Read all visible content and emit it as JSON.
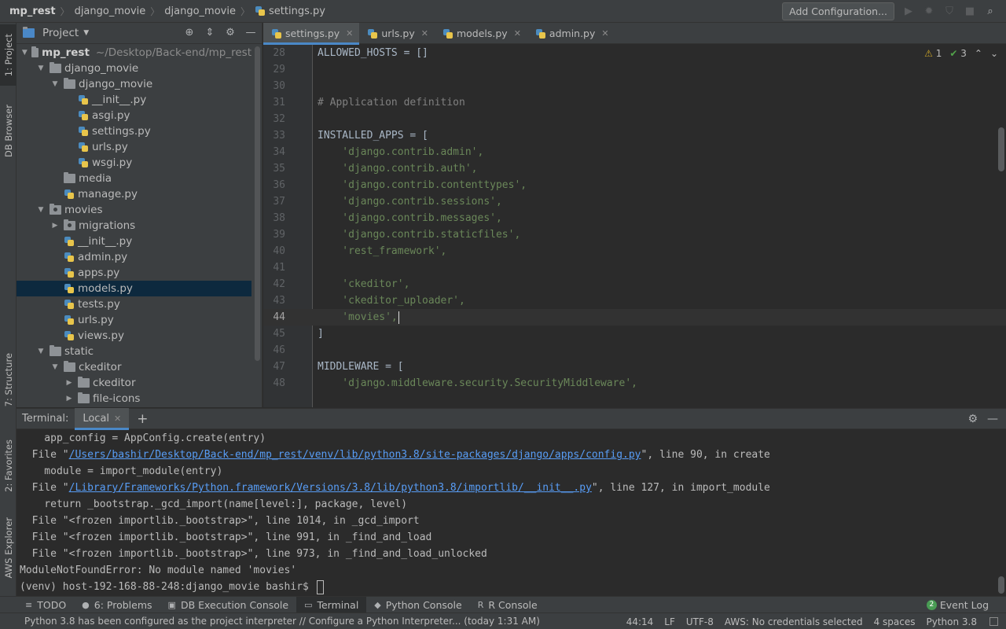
{
  "navbar": {
    "crumbs": [
      "mp_rest",
      "django_movie",
      "django_movie",
      "settings.py"
    ],
    "add_config_label": "Add Configuration..."
  },
  "left_strip": {
    "tabs": [
      "1: Project",
      "DB Browser",
      "7: Structure",
      "2: Favorites",
      "AWS Explorer"
    ]
  },
  "project": {
    "title": "Project",
    "tree": [
      {
        "label": "mp_rest",
        "sub": "~/Desktop/Back-end/mp_rest",
        "depth": 0,
        "type": "folder",
        "arrow": "down",
        "bold": true
      },
      {
        "label": "django_movie",
        "depth": 1,
        "type": "folder",
        "arrow": "down"
      },
      {
        "label": "django_movie",
        "depth": 2,
        "type": "folder",
        "arrow": "down"
      },
      {
        "label": "__init__.py",
        "depth": 3,
        "type": "py"
      },
      {
        "label": "asgi.py",
        "depth": 3,
        "type": "py"
      },
      {
        "label": "settings.py",
        "depth": 3,
        "type": "py"
      },
      {
        "label": "urls.py",
        "depth": 3,
        "type": "py"
      },
      {
        "label": "wsgi.py",
        "depth": 3,
        "type": "py"
      },
      {
        "label": "media",
        "depth": 2,
        "type": "folder"
      },
      {
        "label": "manage.py",
        "depth": 2,
        "type": "py"
      },
      {
        "label": "movies",
        "depth": 1,
        "type": "package",
        "arrow": "down"
      },
      {
        "label": "migrations",
        "depth": 2,
        "type": "package",
        "arrow": "right"
      },
      {
        "label": "__init__.py",
        "depth": 2,
        "type": "py"
      },
      {
        "label": "admin.py",
        "depth": 2,
        "type": "py"
      },
      {
        "label": "apps.py",
        "depth": 2,
        "type": "py"
      },
      {
        "label": "models.py",
        "depth": 2,
        "type": "py",
        "selected": true
      },
      {
        "label": "tests.py",
        "depth": 2,
        "type": "py"
      },
      {
        "label": "urls.py",
        "depth": 2,
        "type": "py"
      },
      {
        "label": "views.py",
        "depth": 2,
        "type": "py"
      },
      {
        "label": "static",
        "depth": 1,
        "type": "folder",
        "arrow": "down"
      },
      {
        "label": "ckeditor",
        "depth": 2,
        "type": "folder",
        "arrow": "down"
      },
      {
        "label": "ckeditor",
        "depth": 3,
        "type": "folder",
        "arrow": "right"
      },
      {
        "label": "file-icons",
        "depth": 3,
        "type": "folder",
        "arrow": "right"
      }
    ]
  },
  "editor": {
    "tabs": [
      {
        "label": "settings.py",
        "active": true
      },
      {
        "label": "urls.py"
      },
      {
        "label": "models.py"
      },
      {
        "label": "admin.py"
      }
    ],
    "warnings": "1",
    "checks": "3",
    "current_line": 44,
    "lines": [
      {
        "n": "28",
        "text": "ALLOWED_HOSTS = []",
        "kind": "code"
      },
      {
        "n": "29",
        "text": "",
        "kind": "code"
      },
      {
        "n": "30",
        "text": "",
        "kind": "code"
      },
      {
        "n": "31",
        "text": "# Application definition",
        "kind": "comment"
      },
      {
        "n": "32",
        "text": "",
        "kind": "code"
      },
      {
        "n": "33",
        "text": "INSTALLED_APPS = [",
        "kind": "code"
      },
      {
        "n": "34",
        "text": "    'django.contrib.admin',",
        "kind": "str"
      },
      {
        "n": "35",
        "text": "    'django.contrib.auth',",
        "kind": "str"
      },
      {
        "n": "36",
        "text": "    'django.contrib.contenttypes',",
        "kind": "str"
      },
      {
        "n": "37",
        "text": "    'django.contrib.sessions',",
        "kind": "str"
      },
      {
        "n": "38",
        "text": "    'django.contrib.messages',",
        "kind": "str"
      },
      {
        "n": "39",
        "text": "    'django.contrib.staticfiles',",
        "kind": "str"
      },
      {
        "n": "40",
        "text": "    'rest_framework',",
        "kind": "str"
      },
      {
        "n": "41",
        "text": "",
        "kind": "code"
      },
      {
        "n": "42",
        "text": "    'ckeditor',",
        "kind": "str"
      },
      {
        "n": "43",
        "text": "    'ckeditor_uploader',",
        "kind": "str"
      },
      {
        "n": "44",
        "text": "    'movies',",
        "kind": "str"
      },
      {
        "n": "45",
        "text": "]",
        "kind": "code"
      },
      {
        "n": "46",
        "text": "",
        "kind": "code"
      },
      {
        "n": "47",
        "text": "MIDDLEWARE = [",
        "kind": "code"
      },
      {
        "n": "48",
        "text": "    'django.middleware.security.SecurityMiddleware',",
        "kind": "str"
      }
    ]
  },
  "terminal": {
    "title": "Terminal:",
    "tab_label": "Local",
    "lines": [
      {
        "parts": [
          {
            "t": "    app_config = AppConfig.create(entry)"
          }
        ]
      },
      {
        "parts": [
          {
            "t": "  File \""
          },
          {
            "t": "/Users/bashir/Desktop/Back-end/mp_rest/venv/lib/python3.8/site-packages/django/apps/config.py",
            "link": true
          },
          {
            "t": "\", line 90, in create"
          }
        ]
      },
      {
        "parts": [
          {
            "t": "    module = import_module(entry)"
          }
        ]
      },
      {
        "parts": [
          {
            "t": "  File \""
          },
          {
            "t": "/Library/Frameworks/Python.framework/Versions/3.8/lib/python3.8/importlib/__init__.py",
            "link": true
          },
          {
            "t": "\", line 127, in import_module"
          }
        ]
      },
      {
        "parts": [
          {
            "t": "    return _bootstrap._gcd_import(name[level:], package, level)"
          }
        ]
      },
      {
        "parts": [
          {
            "t": "  File \"<frozen importlib._bootstrap>\", line 1014, in _gcd_import"
          }
        ]
      },
      {
        "parts": [
          {
            "t": "  File \"<frozen importlib._bootstrap>\", line 991, in _find_and_load"
          }
        ]
      },
      {
        "parts": [
          {
            "t": "  File \"<frozen importlib._bootstrap>\", line 973, in _find_and_load_unlocked"
          }
        ]
      },
      {
        "parts": [
          {
            "t": "ModuleNotFoundError: No module named 'movies'"
          }
        ]
      },
      {
        "parts": [
          {
            "t": "(venv) host-192-168-88-248:django_movie bashir$ "
          }
        ],
        "prompt": true
      }
    ]
  },
  "tool_windows": [
    {
      "label": "TODO",
      "icon": "≡"
    },
    {
      "label": "6: Problems",
      "icon": "●"
    },
    {
      "label": "DB Execution Console",
      "icon": "▣"
    },
    {
      "label": "Terminal",
      "icon": "▭",
      "active": true
    },
    {
      "label": "Python Console",
      "icon": "◆"
    },
    {
      "label": "R Console",
      "icon": "R"
    }
  ],
  "event_log": {
    "label": "Event Log",
    "count": "2"
  },
  "status": {
    "message": "Python 3.8 has been configured as the project interpreter // Configure a Python Interpreter... (today 1:31 AM)",
    "position": "44:14",
    "line_sep": "LF",
    "encoding": "UTF-8",
    "aws": "AWS: No credentials selected",
    "indent": "4 spaces",
    "interpreter": "Python 3.8"
  }
}
